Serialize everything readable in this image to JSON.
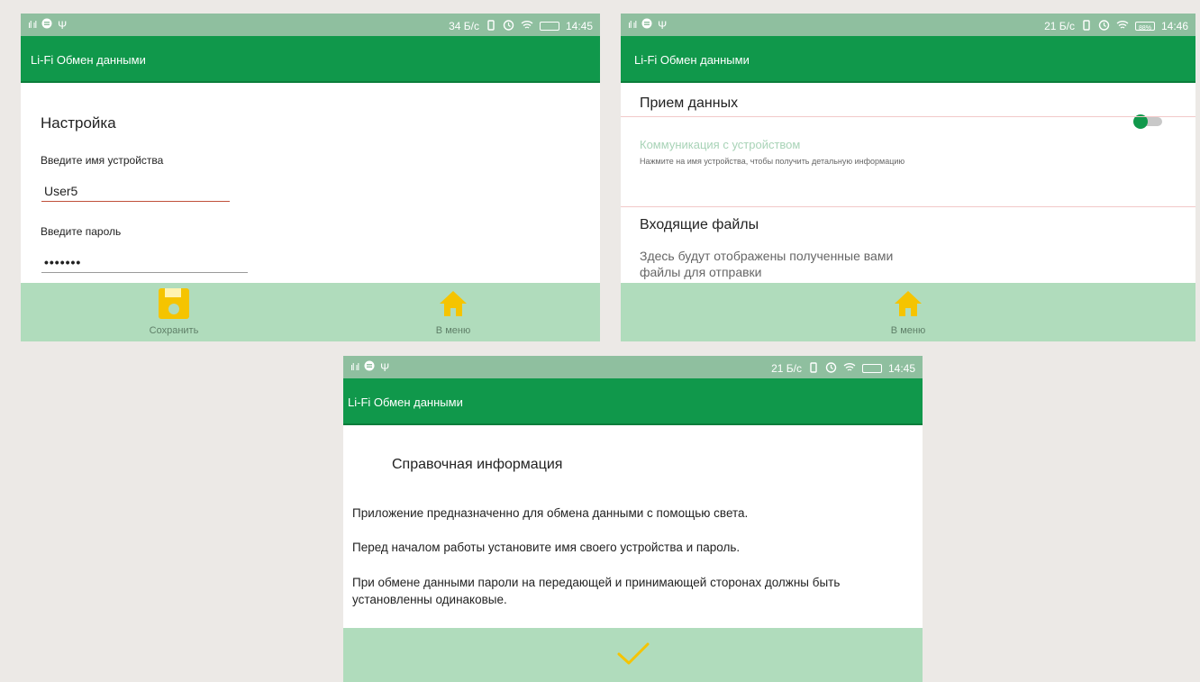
{
  "colors": {
    "statusbar": "#8fbf9f",
    "appbar": "#10984b",
    "bottombar": "#b0dcbc",
    "icon_accent": "#f5c400",
    "input_underline_active": "#c0503a",
    "sublabel": "#a8d3b7"
  },
  "screen1": {
    "status": {
      "speed": "34 Б/с",
      "time": "14:45"
    },
    "app_title": "Li-Fi  Обмен данными",
    "section_title": "Настройка",
    "device_name_label": "Введите имя устройства",
    "device_name_value": "User5",
    "password_label": "Введите пароль",
    "password_value": "•••••••",
    "save_label": "Сохранить",
    "menu_label": "В меню",
    "icons": [
      "save-icon",
      "home-icon"
    ]
  },
  "screen2": {
    "status": {
      "speed": "21 Б/с",
      "battery": "88%",
      "time": "14:46"
    },
    "app_title": "Li-Fi  Обмен данными",
    "receive_title": "Прием данных",
    "receive_toggle_on": true,
    "comm_title": "Коммуникация с устройством",
    "comm_hint": "Нажмите на имя устройства, чтобы получить детальную информацию",
    "incoming_title": "Входящие файлы",
    "incoming_text": "Здесь будут отображены полученные вами файлы для отправки",
    "menu_label": "В меню",
    "icons": [
      "home-icon"
    ]
  },
  "screen3": {
    "status": {
      "speed": "21 Б/с",
      "time": "14:45"
    },
    "app_title": "Li-Fi  Обмен данными",
    "title": "Справочная информация",
    "p1": "Приложение предназначенно для обмена данными с помощью света.",
    "p2": "Перед началом работы установите имя своего устройства и пароль.",
    "p3": "При обмене данными пароли на передающей и принимающей сторонах должны быть установленны одинаковые.",
    "icons": [
      "checkmark-icon"
    ]
  }
}
